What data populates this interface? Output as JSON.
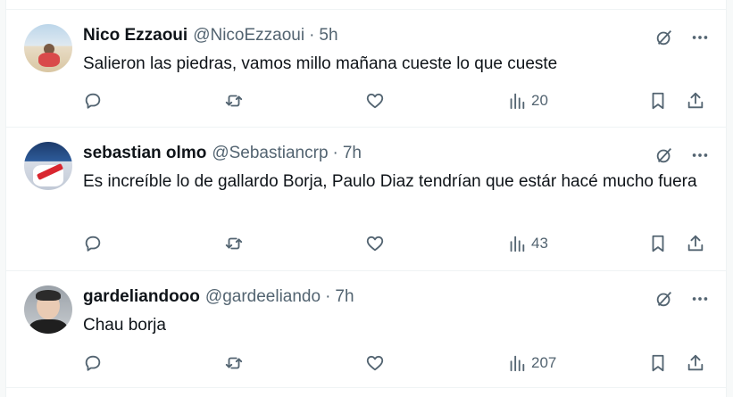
{
  "tweets": [
    {
      "name": "Nico Ezzaoui",
      "handle": "@NicoEzzaoui",
      "separator": "·",
      "time": "5h",
      "text": "Salieron las piedras, vamos millo mañana cueste lo que cueste",
      "views": "20"
    },
    {
      "name": "sebastian olmo",
      "handle": "@Sebastiancrp",
      "separator": "·",
      "time": "7h",
      "text": "Es increíble lo de gallardo Borja, Paulo Diaz tendrían que estár hacé mucho fuera",
      "views": "43"
    },
    {
      "name": "gardeliandooo",
      "handle": "@gardeeliando",
      "separator": "·",
      "time": "7h",
      "text": "Chau borja",
      "views": "207"
    }
  ],
  "icons": {
    "reply": "reply-icon",
    "repost": "repost-icon",
    "like": "heart-icon",
    "views": "views-chart-icon",
    "bookmark": "bookmark-icon",
    "share": "share-icon",
    "grok": "grok-icon",
    "more": "more-icon"
  },
  "colors": {
    "text": "#0f1419",
    "secondary": "#536471",
    "border": "#eff3f4",
    "background": "#ffffff"
  }
}
